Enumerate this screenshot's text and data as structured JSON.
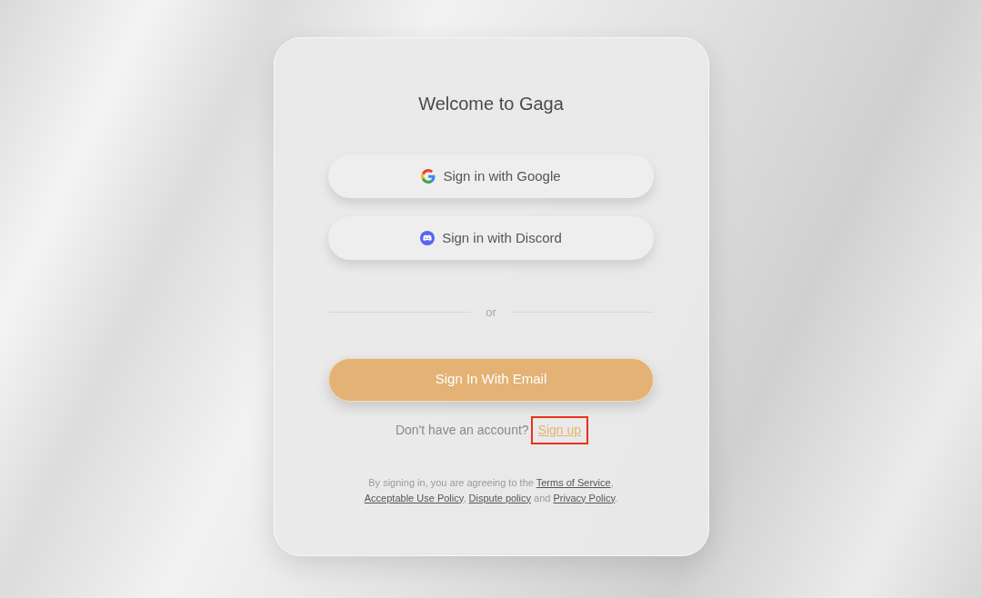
{
  "title": "Welcome to Gaga",
  "providers": [
    {
      "kind": "google",
      "label": "Sign in with Google"
    },
    {
      "kind": "discord",
      "label": "Sign in with Discord"
    }
  ],
  "divider": "or",
  "email_button": "Sign In With Email",
  "signup": {
    "prompt": "Don't have an account?",
    "link": "Sign up",
    "highlighted": true
  },
  "legal": [
    {
      "kind": "text",
      "text": "By signing in, you are agreeing to the "
    },
    {
      "kind": "link",
      "text": "Terms of Service"
    },
    {
      "kind": "text",
      "text": ", "
    },
    {
      "kind": "link",
      "text": "Acceptable Use Policy"
    },
    {
      "kind": "text",
      "text": ", "
    },
    {
      "kind": "link",
      "text": "Dispute policy"
    },
    {
      "kind": "text",
      "text": " and "
    },
    {
      "kind": "link",
      "text": "Privacy Policy"
    },
    {
      "kind": "text",
      "text": "."
    }
  ]
}
